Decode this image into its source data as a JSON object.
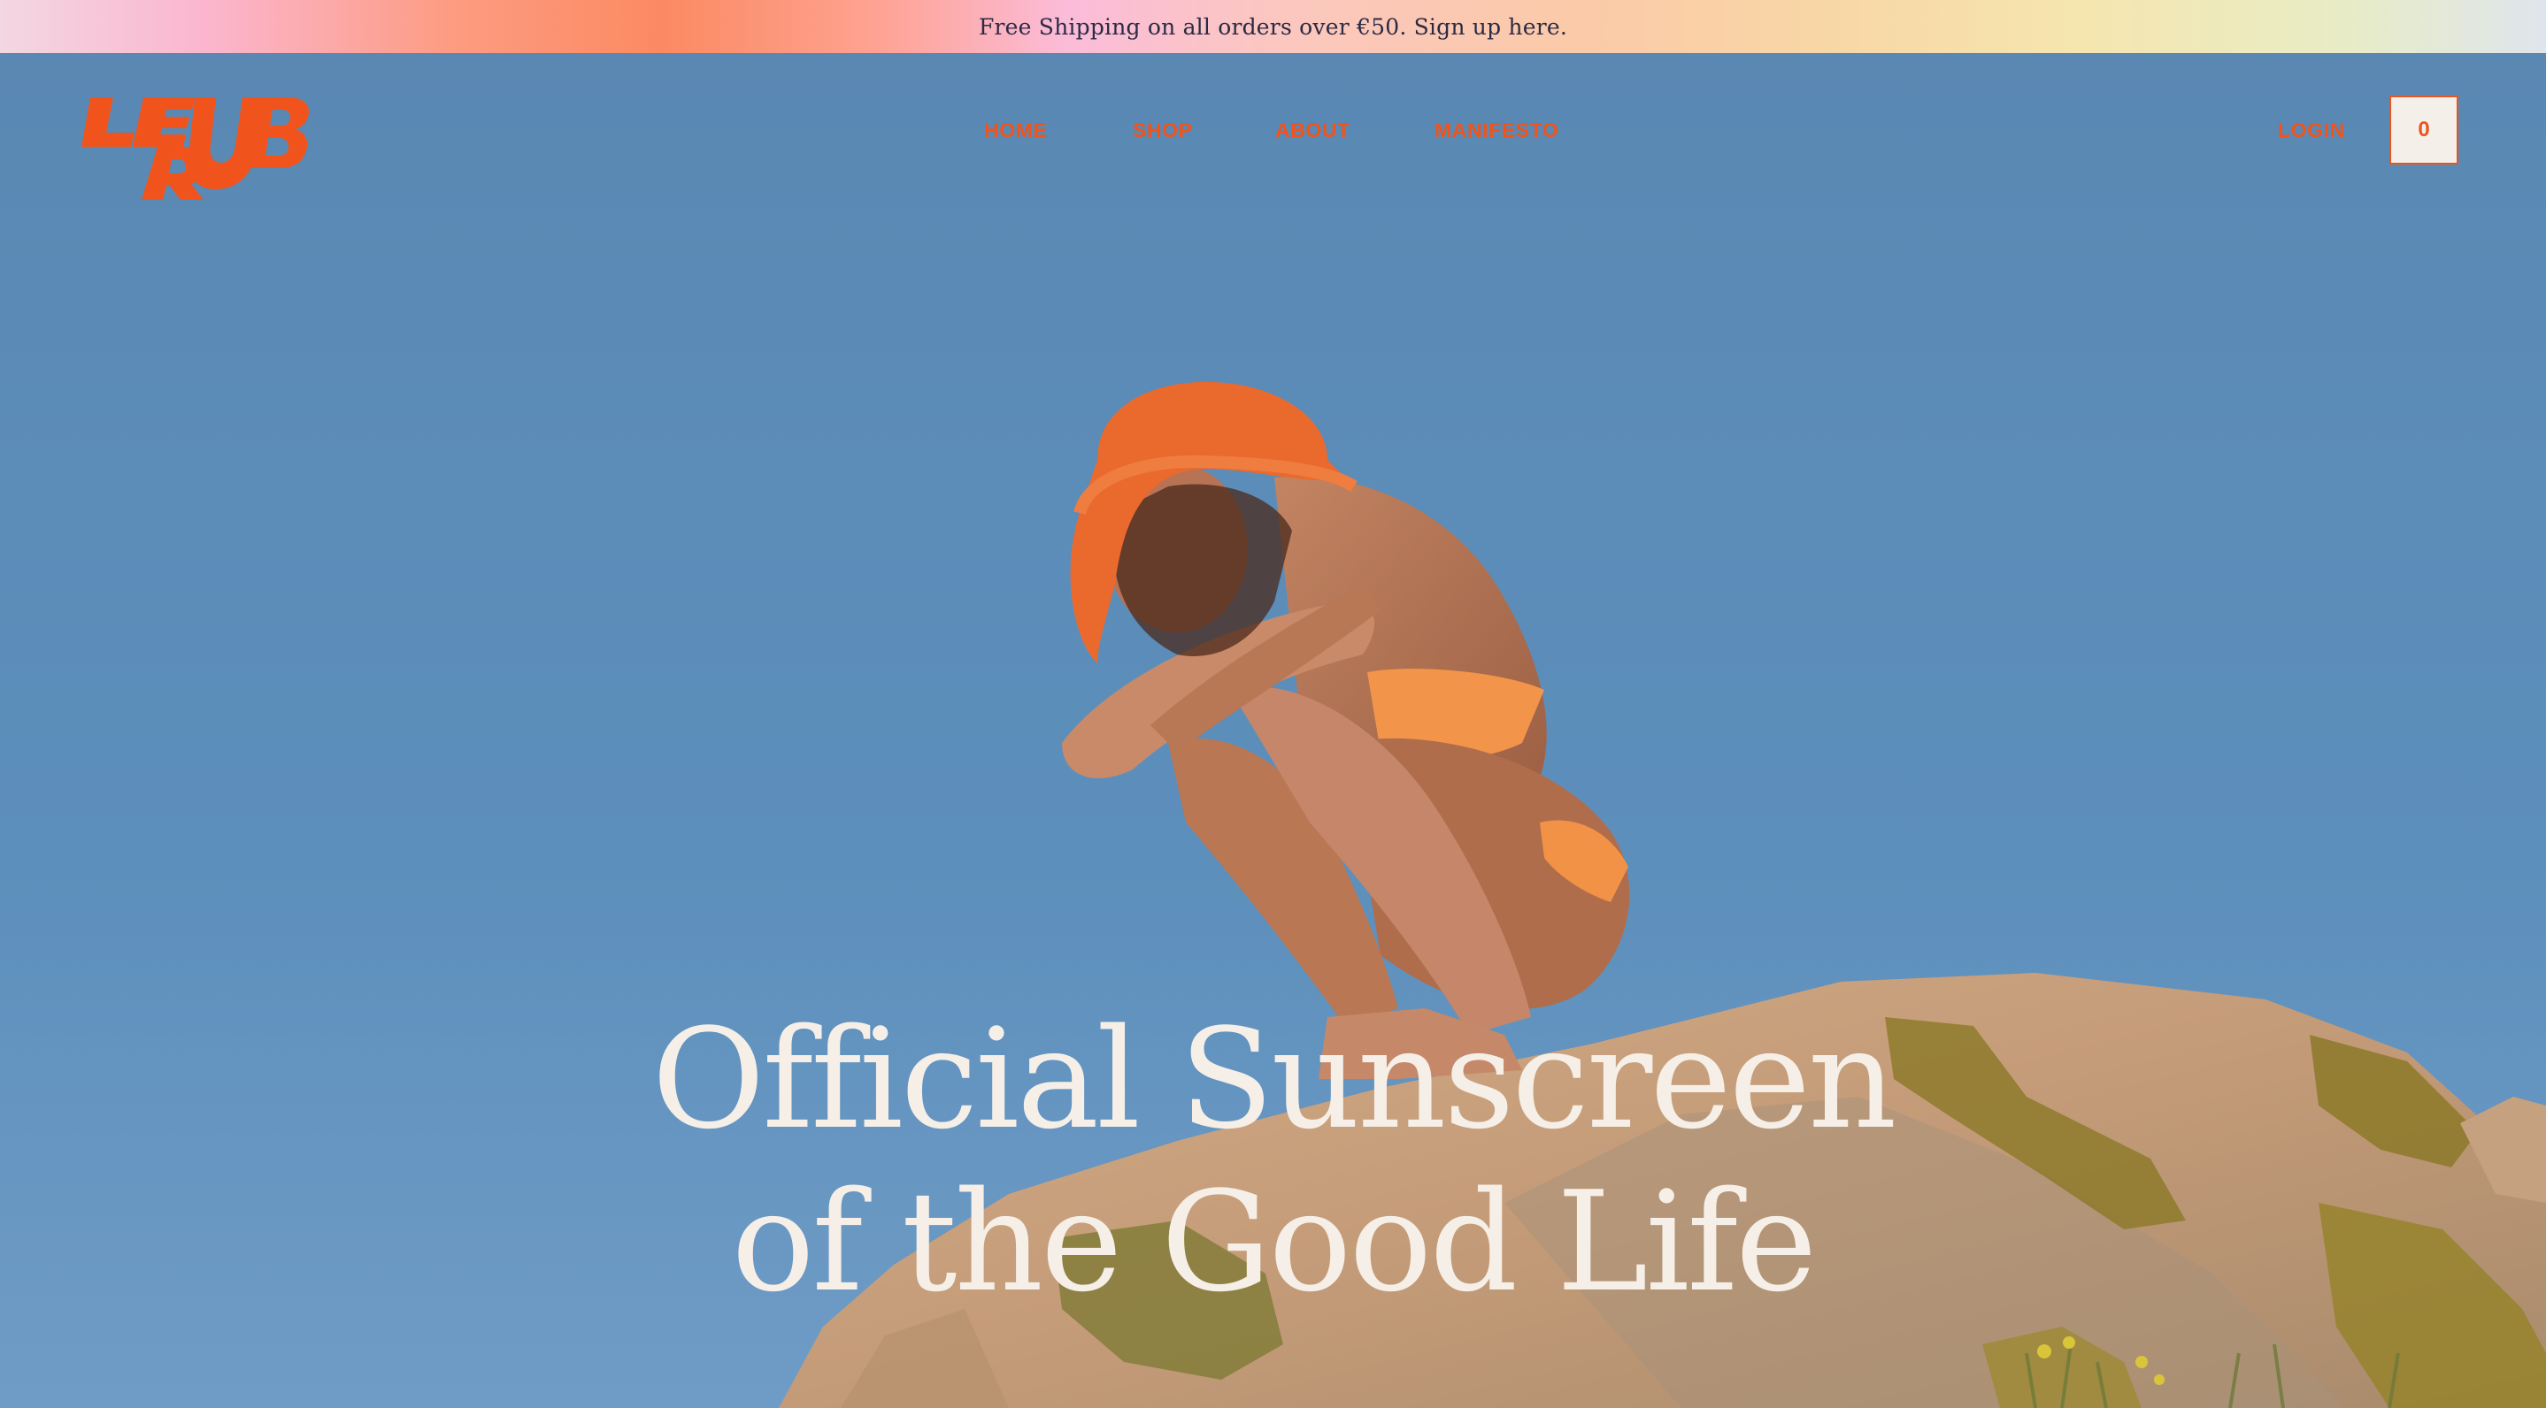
{
  "announcement": {
    "text": "Free Shipping on all orders over €50. Sign up here."
  },
  "brand": {
    "logo_text": "LE RUB",
    "accent_color": "#f0541c"
  },
  "nav": {
    "items": [
      {
        "label": "HOME"
      },
      {
        "label": "SHOP"
      },
      {
        "label": "ABOUT"
      },
      {
        "label": "MANIFESTO"
      }
    ],
    "login_label": "LOGIN",
    "cart_count": "0"
  },
  "hero": {
    "headline_line1": "Official Sunscreen",
    "headline_line2": "of the Good Life",
    "image_alt": "Woman in orange bucket hat and bikini crouching on a rock against blue sky"
  }
}
